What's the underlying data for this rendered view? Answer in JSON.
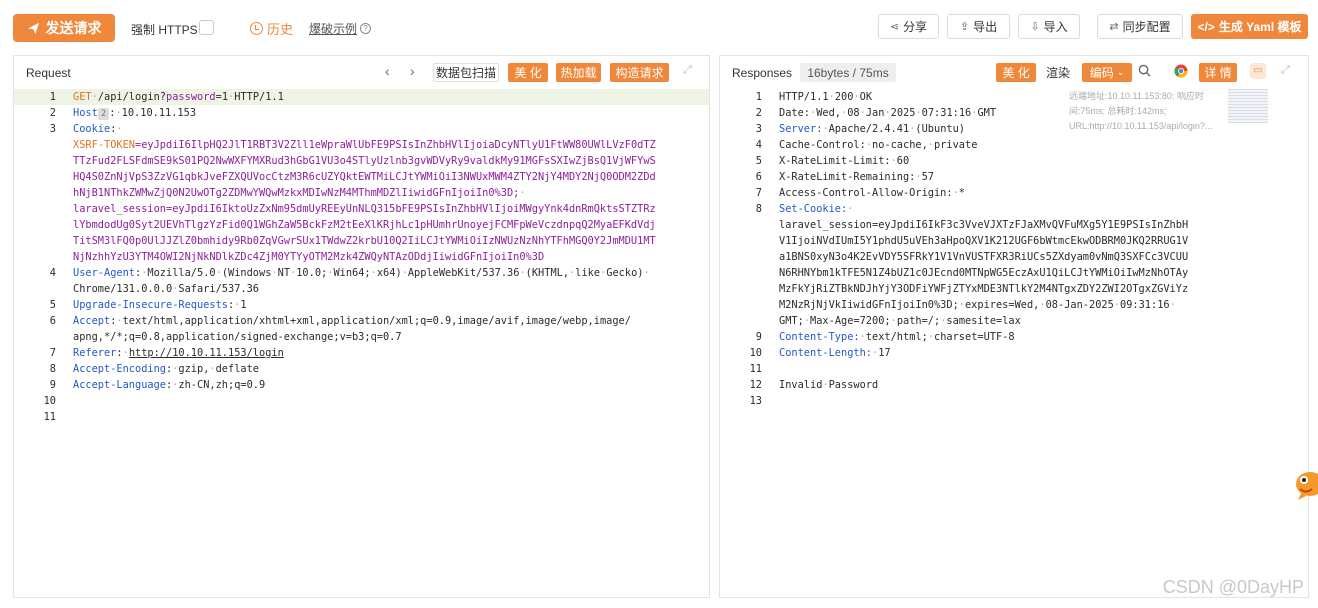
{
  "toolbar": {
    "send_label": "发送请求",
    "https_label": "强制 HTTPS",
    "history_label": "历史",
    "example_label": "爆破示例",
    "share_label": "分享",
    "export_label": "导出",
    "import_label": "导入",
    "sync_label": "同步配置",
    "yaml_label": "生成 Yaml 模板"
  },
  "request_panel": {
    "title": "Request",
    "scan_label": "数据包扫描",
    "beautify_label": "美 化",
    "hotload_label": "热加载",
    "build_label": "构造请求",
    "lines": [
      {
        "n": "1",
        "segments": [
          [
            "k-orange",
            "GET"
          ],
          [
            "dot",
            "·"
          ],
          [
            "",
            "/api/login?"
          ],
          [
            "k-purple",
            "password"
          ],
          [
            "",
            "="
          ],
          [
            "",
            "1"
          ],
          [
            "dot",
            "·"
          ],
          [
            "",
            "HTTP/1.1"
          ]
        ]
      },
      {
        "n": "2",
        "segments": [
          [
            "k-blue",
            "Host"
          ],
          [
            "badge",
            "2"
          ],
          [
            "",
            ":"
          ],
          [
            "dot",
            "·"
          ],
          [
            "",
            "10.10.11.153"
          ]
        ]
      },
      {
        "n": "3",
        "segments": [
          [
            "k-blue",
            "Cookie"
          ],
          [
            "",
            ":"
          ],
          [
            "dot",
            "·"
          ]
        ]
      },
      {
        "n": "",
        "segments": [
          [
            "k-orange",
            "XSRF-TOKEN"
          ],
          [
            "k-purple",
            "=eyJpdiI6IlpHQ2JlT1RBT3V2Zll1eWpraWlUbFE9PSIsInZhbHVlIjoiaDcyNTlyU1FtWW80UWlLVzF0dTZ"
          ]
        ]
      },
      {
        "n": "",
        "segments": [
          [
            "k-purple",
            "TTzFud2FLSFdmSE9kS01PQ2NwWXFYMXRud3hGbG1VU3o4STlyUzlnb3gvWDVyRy9valdkMy91MGFsSXIwZjBsQ1VjWFYwS"
          ]
        ]
      },
      {
        "n": "",
        "segments": [
          [
            "k-purple",
            "HQ4S0ZnNjVpS3ZzVG1qbkJveFZXQUVocCtzM3R6cUZYQktEWTMiLCJtYWMiOiI3NWUxMWM4ZTY2NjY4MDY2NjQ0ODM2ZDd"
          ]
        ]
      },
      {
        "n": "",
        "segments": [
          [
            "k-purple",
            "hNjB1NThkZWMwZjQ0N2UwOTg2ZDMwYWQwMzkxMDIwNzM4MThmMDZlIiwidGFnIjoiIn0%3D;"
          ],
          [
            "dot",
            "·"
          ]
        ]
      },
      {
        "n": "",
        "segments": [
          [
            "k-purple",
            "laravel_session=eyJpdiI6IktoUzZxNm95dmUyREEyUnNLQ315bFE9PSIsInZhbHVlIjoiMWgyYnk4dnRmQktsSTZTRz"
          ]
        ]
      },
      {
        "n": "",
        "segments": [
          [
            "k-purple",
            "lYbmdodUg0Syt2UEVhTlgzYzFid0Q1WGhZaW5BckFzM2tEeXlKRjhLc1pHUmhrUnoyejFCMFpWeVczdnpqQ2MyaEFKdVdj"
          ]
        ]
      },
      {
        "n": "",
        "segments": [
          [
            "k-purple",
            "TitSM3lFQ0p0UlJJZlZ0bmhidy9Rb0ZqVGwrSUx1TWdwZ2krbU10Q2IiLCJtYWMiOiIzNWUzNzNhYTFhMGQ0Y2JmMDU1MT"
          ]
        ]
      },
      {
        "n": "",
        "segments": [
          [
            "k-purple",
            "NjNzhhYzU3YTM4OWI2NjNkNDlkZDc4ZjM0YTYyOTM2Mzk4ZWQyNTAzODdjIiwidGFnIjoiIn0%3D"
          ]
        ]
      },
      {
        "n": "4",
        "segments": [
          [
            "k-blue",
            "User-Agent"
          ],
          [
            "",
            ":"
          ],
          [
            "dot",
            "·"
          ],
          [
            "",
            "Mozilla/5.0"
          ],
          [
            "dot",
            "·"
          ],
          [
            "",
            "(Windows"
          ],
          [
            "dot",
            "·"
          ],
          [
            "",
            "NT"
          ],
          [
            "dot",
            "·"
          ],
          [
            "",
            "10.0;"
          ],
          [
            "dot",
            "·"
          ],
          [
            "",
            "Win64;"
          ],
          [
            "dot",
            "·"
          ],
          [
            "",
            "x64)"
          ],
          [
            "dot",
            "·"
          ],
          [
            "",
            "AppleWebKit/537.36"
          ],
          [
            "dot",
            "·"
          ],
          [
            "",
            "(KHTML,"
          ],
          [
            "dot",
            "·"
          ],
          [
            "",
            "like"
          ],
          [
            "dot",
            "·"
          ],
          [
            "",
            "Gecko)"
          ],
          [
            "dot",
            "·"
          ]
        ]
      },
      {
        "n": "",
        "segments": [
          [
            "",
            "Chrome/131.0.0.0"
          ],
          [
            "dot",
            "·"
          ],
          [
            "",
            "Safari/537.36"
          ]
        ]
      },
      {
        "n": "5",
        "segments": [
          [
            "k-blue",
            "Upgrade-Insecure-Requests"
          ],
          [
            "",
            ":"
          ],
          [
            "dot",
            "·"
          ],
          [
            "",
            "1"
          ]
        ]
      },
      {
        "n": "6",
        "segments": [
          [
            "k-blue",
            "Accept"
          ],
          [
            "",
            ":"
          ],
          [
            "dot",
            "·"
          ],
          [
            "",
            "text/html,application/xhtml+xml,application/xml;q=0.9,image/avif,image/webp,image/"
          ]
        ]
      },
      {
        "n": "",
        "segments": [
          [
            "",
            "apng,*/*;q=0.8,application/signed-exchange;v=b3;q=0.7"
          ]
        ]
      },
      {
        "n": "7",
        "segments": [
          [
            "k-blue",
            "Referer"
          ],
          [
            "",
            ":"
          ],
          [
            "dot",
            "·"
          ],
          [
            "k-link",
            "http://10.10.11.153/login"
          ]
        ]
      },
      {
        "n": "8",
        "segments": [
          [
            "k-blue",
            "Accept-Encoding"
          ],
          [
            "",
            ":"
          ],
          [
            "dot",
            "·"
          ],
          [
            "",
            "gzip,"
          ],
          [
            "dot",
            "·"
          ],
          [
            "",
            "deflate"
          ]
        ]
      },
      {
        "n": "9",
        "segments": [
          [
            "k-blue",
            "Accept-Language"
          ],
          [
            "",
            ":"
          ],
          [
            "dot",
            "·"
          ],
          [
            "",
            "zh-CN,zh;q=0.9"
          ]
        ]
      },
      {
        "n": "10",
        "segments": []
      },
      {
        "n": "11",
        "segments": []
      }
    ]
  },
  "response_panel": {
    "title": "Responses",
    "stats": "16bytes / 75ms",
    "beautify_label": "美 化",
    "render_label": "渲染",
    "encoding_label": "编码",
    "details_label": "详 情",
    "meta_note": "远端地址:10.10.11.153:80; 响应时间:75ms; 总耗时:142ms; URL:http://10.10.11.153/api/login?...",
    "lines": [
      {
        "n": "1",
        "segments": [
          [
            "",
            "HTTP/1.1"
          ],
          [
            "dot",
            "·"
          ],
          [
            "",
            "200"
          ],
          [
            "dot",
            "·"
          ],
          [
            "",
            "OK"
          ]
        ]
      },
      {
        "n": "2",
        "segments": [
          [
            "",
            "Date:"
          ],
          [
            "dot",
            "·"
          ],
          [
            "",
            "Wed,"
          ],
          [
            "dot",
            "·"
          ],
          [
            "",
            "08"
          ],
          [
            "dot",
            "·"
          ],
          [
            "",
            "Jan"
          ],
          [
            "dot",
            "·"
          ],
          [
            "",
            "2025"
          ],
          [
            "dot",
            "·"
          ],
          [
            "",
            "07:31:16"
          ],
          [
            "dot",
            "·"
          ],
          [
            "",
            "GMT"
          ]
        ]
      },
      {
        "n": "3",
        "segments": [
          [
            "k-blue",
            "Server:"
          ],
          [
            "dot",
            "·"
          ],
          [
            "",
            "Apache/2.4.41"
          ],
          [
            "dot",
            "·"
          ],
          [
            "",
            "(Ubuntu)"
          ]
        ]
      },
      {
        "n": "4",
        "segments": [
          [
            "",
            "Cache-Control:"
          ],
          [
            "dot",
            "·"
          ],
          [
            "",
            "no-cache,"
          ],
          [
            "dot",
            "·"
          ],
          [
            "",
            "private"
          ]
        ]
      },
      {
        "n": "5",
        "segments": [
          [
            "",
            "X-RateLimit-Limit:"
          ],
          [
            "dot",
            "·"
          ],
          [
            "",
            "60"
          ]
        ]
      },
      {
        "n": "6",
        "segments": [
          [
            "",
            "X-RateLimit-Remaining:"
          ],
          [
            "dot",
            "·"
          ],
          [
            "",
            "57"
          ]
        ]
      },
      {
        "n": "7",
        "segments": [
          [
            "",
            "Access-Control-Allow-Origin:"
          ],
          [
            "dot",
            "·"
          ],
          [
            "",
            "*"
          ]
        ]
      },
      {
        "n": "8",
        "segments": [
          [
            "k-blue",
            "Set-Cookie:"
          ],
          [
            "dot",
            "·"
          ]
        ]
      },
      {
        "n": "",
        "segments": [
          [
            "",
            "laravel_session=eyJpdiI6IkF3c3VveVJXTzFJaXMvQVFuMXg5Y1E9PSIsInZhbH"
          ]
        ]
      },
      {
        "n": "",
        "segments": [
          [
            "",
            "V1IjoiNVdIUmI5Y1phdU5uVEh3aHpoQXV1K212UGF6bWtmcEkwODBRM0JKQ2RRUG1V"
          ]
        ]
      },
      {
        "n": "",
        "segments": [
          [
            "",
            "a1BNS0xyN3o4K2EvVDY5SFRkY1V1VnVUSTFXR3RiUCs5ZXdyam0vNmQ3SXFCc3VCUU"
          ]
        ]
      },
      {
        "n": "",
        "segments": [
          [
            "",
            "N6RHNYbm1kTFE5N1Z4bUZ1c0JEcnd0MTNpWG5EczAxU1QiLCJtYWMiOiIwMzNhOTAy"
          ]
        ]
      },
      {
        "n": "",
        "segments": [
          [
            "",
            "MzFkYjRiZTBkNDJhYjY3ODFiYWFjZTYxMDE3NTlkY2M4NTgxZDY2ZWI2OTgxZGViYz"
          ]
        ]
      },
      {
        "n": "",
        "segments": [
          [
            "",
            "M2NzRjNjVkIiwidGFnIjoiIn0%3D;"
          ],
          [
            "dot",
            "·"
          ],
          [
            "",
            "expires=Wed,"
          ],
          [
            "dot",
            "·"
          ],
          [
            "",
            "08-Jan-2025"
          ],
          [
            "dot",
            "·"
          ],
          [
            "",
            "09:31:16"
          ],
          [
            "dot",
            "·"
          ]
        ]
      },
      {
        "n": "",
        "segments": [
          [
            "",
            "GMT;"
          ],
          [
            "dot",
            "·"
          ],
          [
            "",
            "Max-Age=7200;"
          ],
          [
            "dot",
            "·"
          ],
          [
            "",
            "path=/;"
          ],
          [
            "dot",
            "·"
          ],
          [
            "",
            "samesite=lax"
          ]
        ]
      },
      {
        "n": "9",
        "segments": [
          [
            "k-blue",
            "Content-Type:"
          ],
          [
            "dot",
            "·"
          ],
          [
            "",
            "text/html;"
          ],
          [
            "dot",
            "·"
          ],
          [
            "",
            "charset=UTF-8"
          ]
        ]
      },
      {
        "n": "10",
        "segments": [
          [
            "k-blue",
            "Content-Length:"
          ],
          [
            "dot",
            "·"
          ],
          [
            "",
            "17"
          ]
        ]
      },
      {
        "n": "11",
        "segments": []
      },
      {
        "n": "12",
        "segments": [
          [
            "",
            "Invalid"
          ],
          [
            "dot",
            "·"
          ],
          [
            "",
            "Password"
          ]
        ]
      },
      {
        "n": "13",
        "segments": []
      }
    ]
  },
  "watermark": "CSDN @0DayHP",
  "colors": {
    "accent": "#f0883c",
    "header_key": "#2458c8",
    "cookie_value": "#8e1e9c",
    "method": "#e07424"
  }
}
